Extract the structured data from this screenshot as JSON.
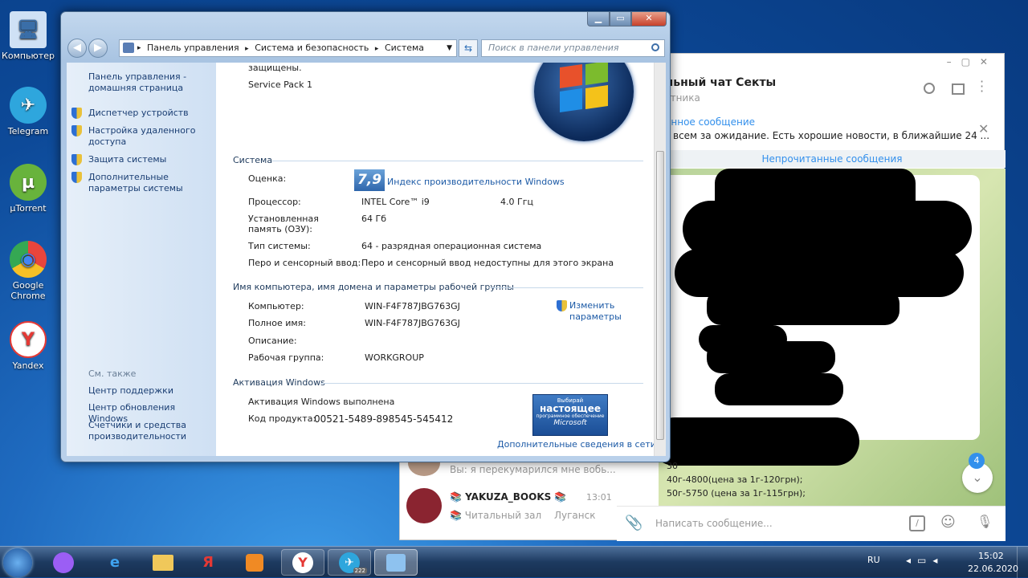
{
  "desktop": {
    "icons": [
      {
        "label": "Компьютер",
        "glyph": "🖥",
        "color": "#8fb7e6"
      },
      {
        "label": "Telegram",
        "glyph": "✈",
        "color": "#2ea6dd"
      },
      {
        "label": "µTorrent",
        "glyph": "µ",
        "color": "#68b33c"
      },
      {
        "label": "Google Chrome",
        "glyph": "◉",
        "color": "#e8453c"
      },
      {
        "label": "Yandex",
        "glyph": "Y",
        "color": "#ffffff"
      }
    ]
  },
  "telegram": {
    "header_title": "льный чат Секты",
    "header_subtitle": "стника",
    "pinned_title": "ённое сообщение",
    "pinned_text": "всем за ожидание. Есть хорошие новости, в ближайшие 24 ...",
    "unread_banner": "Непрочитанные сообщения",
    "chat_list": [
      {
        "preview": "Вы: я перекумарился мне вобь..."
      },
      {
        "name": "📚 YAKUZA_BOOKS 📚",
        "time": "13:01",
        "line1": "📚 Читальный зал",
        "line2": "Луганск"
      }
    ],
    "visible_lines": [
      "30",
      "40г-4800(цена за 1г-120грн);",
      "50г-5750 (цена за 1г-115грн);"
    ],
    "input_placeholder": "Написать сообщение...",
    "unread_badge": "4",
    "accent": "#3390ec"
  },
  "window": {
    "address": {
      "segments": [
        "Панель управления",
        "Система и безопасность",
        "Система"
      ]
    },
    "search_placeholder": "Поиск в панели управления",
    "sidebar": {
      "home": "Панель управления - домашняя страница",
      "links": [
        "Диспетчер устройств",
        "Настройка удаленного доступа",
        "Защита системы",
        "Дополнительные параметры системы"
      ],
      "see_also_title": "См. также",
      "see_also": [
        "Центр поддержки",
        "Центр обновления Windows",
        "Счетчики и средства производительности"
      ]
    },
    "top_text": "защищены.",
    "service_pack": "Service Pack 1",
    "system": {
      "title": "Система",
      "rating_label": "Оценка:",
      "rating_value": "7,9",
      "rating_link": "Индекс производительности Windows",
      "cpu_label": "Процессор:",
      "cpu_value": "INTEL Core™ i9",
      "cpu_freq": "4.0 Ггц",
      "ram_label": "Установленная память (ОЗУ):",
      "ram_value": "64 Гб",
      "type_label": "Тип системы:",
      "type_value": "64 - разрядная операционная система",
      "pen_label": "Перо и сенсорный ввод:",
      "pen_value": "Перо и сенсорный ввод недоступны для этого экрана"
    },
    "computer": {
      "title": "Имя компьютера, имя домена и параметры рабочей группы",
      "name_label": "Компьютер:",
      "name_value": "WIN-F4F787JBG763GJ",
      "full_label": "Полное имя:",
      "full_value": "WIN-F4F787JBG763GJ",
      "desc_label": "Описание:",
      "group_label": "Рабочая группа:",
      "group_value": "WORKGROUP",
      "change_link": "Изменить параметры"
    },
    "activation": {
      "title": "Активация Windows",
      "status": "Активация Windows выполнена",
      "key_label": "Код продукта:",
      "key_value": "00521-5489-898545-545412",
      "badge_line1": "Выбирай",
      "badge_line2": "настоящее",
      "badge_line3": "программное обеспечение",
      "badge_line4": "Microsoft",
      "more_link": "Дополнительные сведения в сети..."
    }
  },
  "taskbar": {
    "lang": "RU",
    "time": "15:02",
    "date": "22.06.2020",
    "telegram_badge": "222"
  }
}
